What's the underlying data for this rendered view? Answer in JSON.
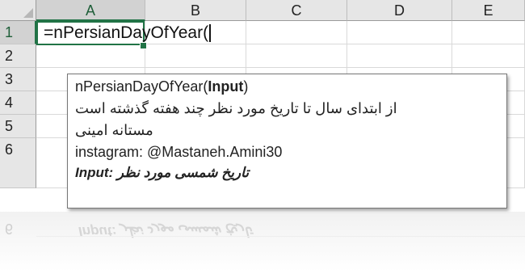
{
  "columns": [
    "A",
    "B",
    "C",
    "D",
    "E"
  ],
  "rows": [
    "1",
    "2",
    "3",
    "4",
    "5",
    "6"
  ],
  "active_cell": {
    "column": "A",
    "row": "1"
  },
  "formula_text": "=nPersianDayOfYear(",
  "tooltip": {
    "signature_name": "nPersianDayOfYear(",
    "signature_param": "Input",
    "signature_close": ")",
    "description": "از ابتدای سال تا تاریخ مورد نظر چند هفته گذشته است",
    "author": "مستانه امینی",
    "instagram": "instagram: @Mastaneh.Amini30",
    "param_help": "Input: تاریخ شمسی مورد نظر"
  },
  "reflection": {
    "row_label": "6",
    "text": "Input: تاریخ شمسی مورد نظر"
  },
  "colors": {
    "accent": "#217346",
    "header_bg": "#e6e6e6",
    "gridline": "#d9d9d9"
  }
}
